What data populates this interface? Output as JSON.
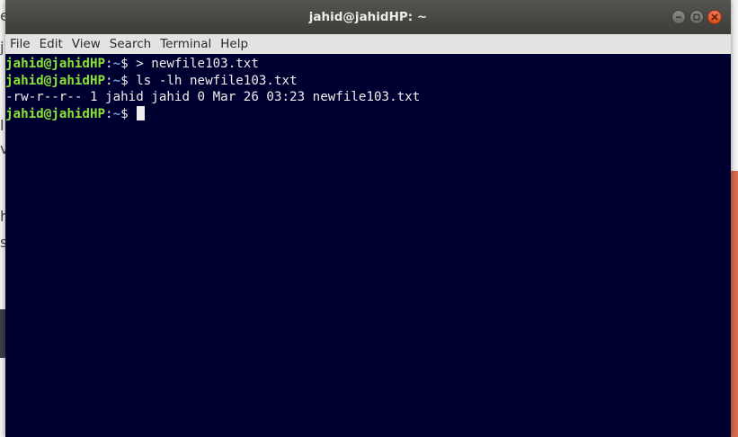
{
  "window": {
    "title": "jahid@jahidHP: ~"
  },
  "menu": [
    "File",
    "Edit",
    "View",
    "Search",
    "Terminal",
    "Help"
  ],
  "terminal": {
    "lines": [
      {
        "user": "jahid@jahidHP",
        "sep": ":",
        "path": "~",
        "symbol": "$",
        "command": " > newfile103.txt"
      },
      {
        "user": "jahid@jahidHP",
        "sep": ":",
        "path": "~",
        "symbol": "$",
        "command": " ls -lh newfile103.txt"
      },
      {
        "output": "-rw-r--r-- 1 jahid jahid 0 Mar 26 03:23 newfile103.txt"
      },
      {
        "user": "jahid@jahidHP",
        "sep": ":",
        "path": "~",
        "symbol": "$",
        "command": " "
      }
    ]
  },
  "colors": {
    "terminal_bg": "#000030",
    "prompt_user": "#8ae234",
    "prompt_path": "#729fcf",
    "text": "#ededed"
  },
  "icons": {
    "minimize": "minimize-icon",
    "maximize": "maximize-icon",
    "close": "close-icon"
  }
}
